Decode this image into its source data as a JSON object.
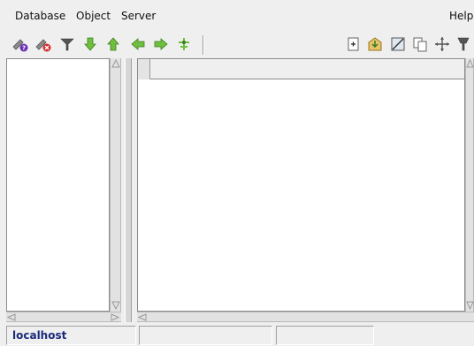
{
  "menu": {
    "database": "Database",
    "object": "Object",
    "server": "Server",
    "help": "Help"
  },
  "toolbar_left": [
    {
      "icon": "connect-info-icon"
    },
    {
      "icon": "disconnect-icon"
    },
    {
      "icon": "filter-icon"
    },
    {
      "icon": "move-down-icon"
    },
    {
      "icon": "move-up-icon"
    },
    {
      "icon": "move-left-icon"
    },
    {
      "icon": "move-right-icon"
    },
    {
      "icon": "pin-icon"
    }
  ],
  "toolbar_right": [
    {
      "icon": "new-page-icon"
    },
    {
      "icon": "open-icon"
    },
    {
      "icon": "image-icon"
    },
    {
      "icon": "copy-icon"
    },
    {
      "icon": "move-icon"
    },
    {
      "icon": "brush-icon"
    }
  ],
  "status": {
    "host": "localhost",
    "cell2": "",
    "cell3": ""
  },
  "colors": {
    "accent": "#1b2a7a",
    "background": "#efefef",
    "panel": "#ffffff"
  }
}
